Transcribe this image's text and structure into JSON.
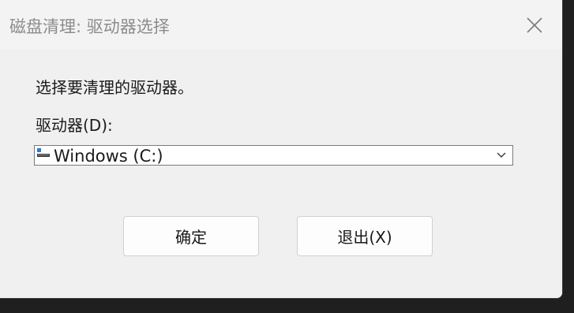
{
  "window": {
    "title": "磁盘清理: 驱动器选择",
    "close_icon": "close-icon"
  },
  "dialog": {
    "prompt": "选择要清理的驱动器。",
    "drive_label": "驱动器(D):",
    "drive_select": {
      "value": "Windows (C:)",
      "icon": "drive-icon"
    },
    "ok_label": "确定",
    "exit_label": "退出(X)"
  },
  "colors": {
    "window_bg": "#f3f3f3",
    "title_text": "#8c8c8c",
    "button_border": "#d0d0d0"
  }
}
